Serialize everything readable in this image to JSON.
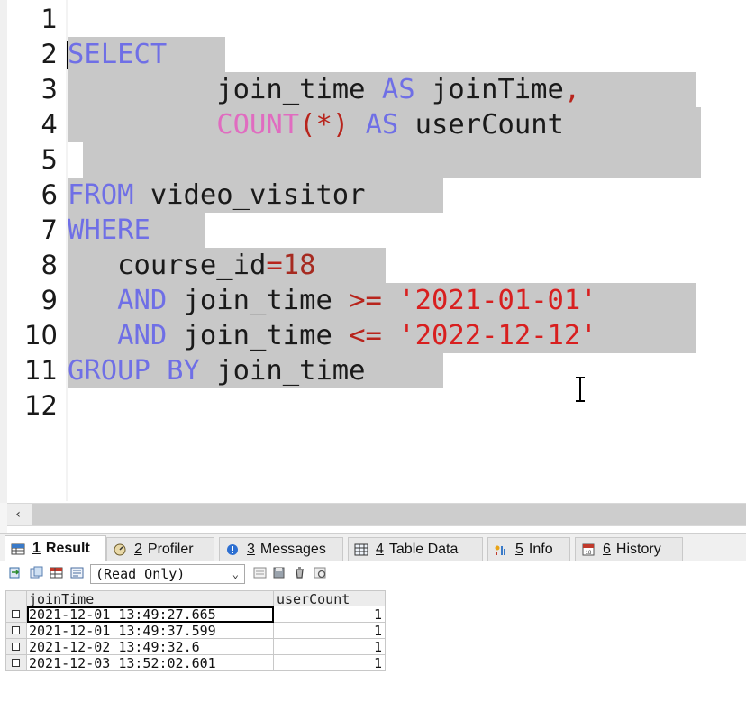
{
  "editor": {
    "line_numbers": [
      "1",
      "2",
      "3",
      "4",
      "5",
      "6",
      "7",
      "8",
      "9",
      "10",
      "11",
      "12"
    ],
    "lines": [
      [],
      [
        {
          "t": "SELECT",
          "c": "kw"
        }
      ],
      [
        {
          "t": "         join_time ",
          "c": ""
        },
        {
          "t": "AS",
          "c": "kw"
        },
        {
          "t": " joinTime",
          "c": ""
        },
        {
          "t": ",",
          "c": "op"
        }
      ],
      [
        {
          "t": "         ",
          "c": ""
        },
        {
          "t": "COUNT",
          "c": "fn"
        },
        {
          "t": "(*)",
          "c": "op"
        },
        {
          "t": " ",
          "c": ""
        },
        {
          "t": "AS",
          "c": "kw"
        },
        {
          "t": " userCount",
          "c": ""
        }
      ],
      [],
      [
        {
          "t": "FROM",
          "c": "kw"
        },
        {
          "t": " video_visitor",
          "c": ""
        }
      ],
      [
        {
          "t": "WHERE",
          "c": "kw"
        }
      ],
      [
        {
          "t": "   course_id",
          "c": ""
        },
        {
          "t": "=",
          "c": "op"
        },
        {
          "t": "18",
          "c": "num"
        }
      ],
      [
        {
          "t": "   ",
          "c": ""
        },
        {
          "t": "AND",
          "c": "kw"
        },
        {
          "t": " join_time ",
          "c": ""
        },
        {
          "t": ">=",
          "c": "op"
        },
        {
          "t": " ",
          "c": ""
        },
        {
          "t": "'2021-01-01'",
          "c": "str"
        }
      ],
      [
        {
          "t": "   ",
          "c": ""
        },
        {
          "t": "AND",
          "c": "kw"
        },
        {
          "t": " join_time ",
          "c": ""
        },
        {
          "t": "<=",
          "c": "op"
        },
        {
          "t": " ",
          "c": ""
        },
        {
          "t": "'2022-12-12'",
          "c": "str"
        }
      ],
      [
        {
          "t": "GROUP BY",
          "c": "kw"
        },
        {
          "t": " join_time",
          "c": ""
        }
      ],
      []
    ]
  },
  "tabs": [
    {
      "key": "1",
      "label": "Result",
      "icon": "result-grid-icon",
      "active": true
    },
    {
      "key": "2",
      "label": "Profiler",
      "icon": "profiler-icon",
      "active": false
    },
    {
      "key": "3",
      "label": "Messages",
      "icon": "messages-icon",
      "active": false
    },
    {
      "key": "4",
      "label": "Table Data",
      "icon": "table-data-icon",
      "active": false
    },
    {
      "key": "5",
      "label": "Info",
      "icon": "info-icon",
      "active": false
    },
    {
      "key": "6",
      "label": "History",
      "icon": "history-icon",
      "active": false
    }
  ],
  "toolbar": {
    "mode_select": "(Read Only)"
  },
  "grid": {
    "columns": [
      "joinTime",
      "userCount"
    ],
    "rows": [
      [
        "2021-12-01 13:49:27.665",
        "1"
      ],
      [
        "2021-12-01 13:49:37.599",
        "1"
      ],
      [
        "2021-12-02 13:49:32.6",
        "1"
      ],
      [
        "2021-12-03 13:52:02.601",
        "1"
      ]
    ]
  },
  "colors": {
    "keyword": "#6f6fe6",
    "function": "#e06cc0",
    "operator": "#b8241c",
    "string": "#d81f1f",
    "selection": "#c8c8c8"
  }
}
